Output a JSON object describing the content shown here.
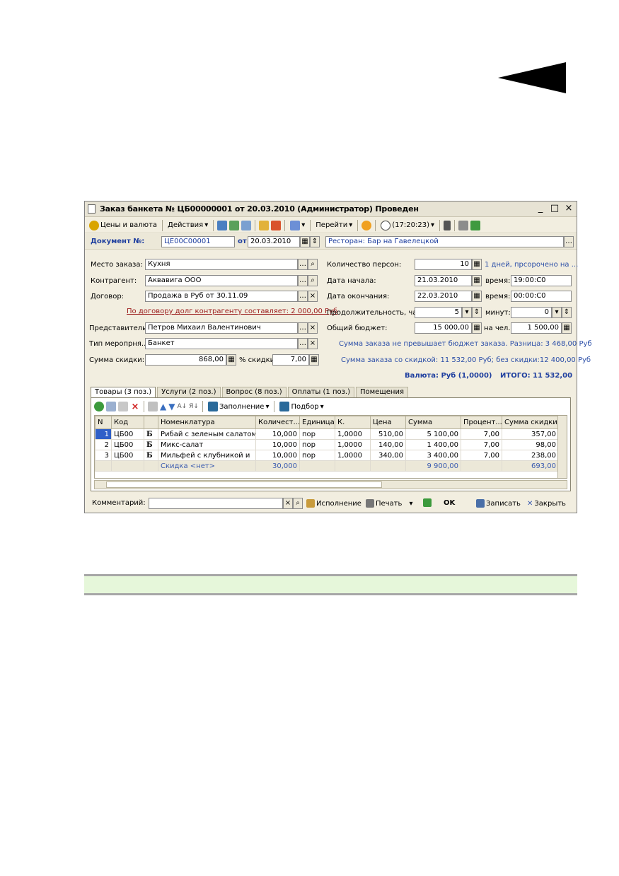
{
  "window": {
    "title": "Заказ банкета № ЦБ00000001 от 20.03.2010 (Администратор) Проведен",
    "controls": [
      "_",
      "□",
      "×"
    ]
  },
  "toolbar": {
    "prices_label": "Цены и валюта",
    "actions_label": "Действия",
    "goto_label": "Перейти",
    "time_label": "(17:20:23)"
  },
  "doc": {
    "label": "Документ №:",
    "number": "ЦЕ00С00001",
    "from_label": "от",
    "date": "20.03.2010",
    "restaurant": "Ресторан: Бар на Гавелецкой"
  },
  "left": {
    "place_label": "Место заказа:",
    "place_value": "Кухня",
    "contractor_label": "Контрагент:",
    "contractor_value": "Аквавига ООО",
    "contract_label": "Договор:",
    "contract_value": "Продажа в Руб от 30.11.09",
    "debt_link": "По договору долг контрагенту составляет: 2 000,00 Руб",
    "rep_label": "Представитель:",
    "rep_value": "Петров Михаил Валентинович",
    "event_label": "Тип меропрня...",
    "event_value": "Банкет",
    "discount_sum_label": "Сумма скидки:",
    "discount_sum_value": "868,00",
    "discount_pct_label": "% скидки:",
    "discount_pct_value": "7,00"
  },
  "right": {
    "persons_label": "Количество персон:",
    "persons_value": "10",
    "days_info": "1 дней, прсорочено на ...",
    "start_label": "Дата начала:",
    "start_value": "21.03.2010",
    "time_label": "время:",
    "start_time": "19:00:С0",
    "end_label": "Дата окончания:",
    "end_value": "22.03.2010",
    "end_time": "00:00:С0",
    "duration_label": "Продолжительность, час:",
    "duration_value": "5",
    "minutes_label": "минут:",
    "minutes_value": "0",
    "budget_label": "Общий бюджет:",
    "budget_value": "15 000,00",
    "per_person_label": "на чел.:",
    "per_person_value": "1 500,00",
    "budget_info": "Сумма заказа не превышает бюджет заказа. Разница: 3 468,00 Руб",
    "sum_info": "Сумма заказа со скидкой: 11 532,00 Руб; без скидки:12 400,00 Руб",
    "currency": "Валюта: Руб (1,0000)",
    "total": "ИТОГО: 11 532,00"
  },
  "tabs": [
    "Товары (3 поз.)",
    "Услуги (2 поз.)",
    "Вопрос (8 поз.)",
    "Оплаты (1 поз.)",
    "Помещения"
  ],
  "table_toolbar": {
    "fill_label": "Заполнение",
    "select_label": "Подбор"
  },
  "table": {
    "columns": [
      "N",
      "Код",
      "",
      "Номенклатура",
      "Количест...",
      "Единица",
      "К.",
      "Цена",
      "Сумма",
      "Процент...",
      "Сумма скидки"
    ],
    "rows": [
      [
        "1",
        "ЦБ00",
        "Б",
        "Рибай с зеленым салатом",
        "10,000",
        "пор",
        "1,0000",
        "510,00",
        "5 100,00",
        "7,00",
        "357,00"
      ],
      [
        "2",
        "ЦБ00",
        "Б",
        "Микс-салат",
        "10,000",
        "пор",
        "1,0000",
        "140,00",
        "1 400,00",
        "7,00",
        "98,00"
      ],
      [
        "3",
        "ЦБ00",
        "Б",
        "Мильфей с клубникой и",
        "10,000",
        "пор",
        "1,0000",
        "340,00",
        "3 400,00",
        "7,00",
        "238,00"
      ]
    ],
    "total_row": [
      "",
      "",
      "",
      "Скидка <нет>",
      "30,000",
      "",
      "",
      "",
      "9 900,00",
      "",
      "693,00"
    ]
  },
  "bottom": {
    "comment_label": "Комментарий:",
    "execution_label": "Исполнение",
    "print_label": "Печать",
    "ok_label": "OK",
    "save_label": "Записать",
    "close_label": "Закрыть"
  },
  "colors": {
    "accent_blue": "#1f3f9f",
    "info_blue": "#2c4fa8",
    "link_red": "#9b1b1b",
    "window_bg": "#f2eee0"
  }
}
